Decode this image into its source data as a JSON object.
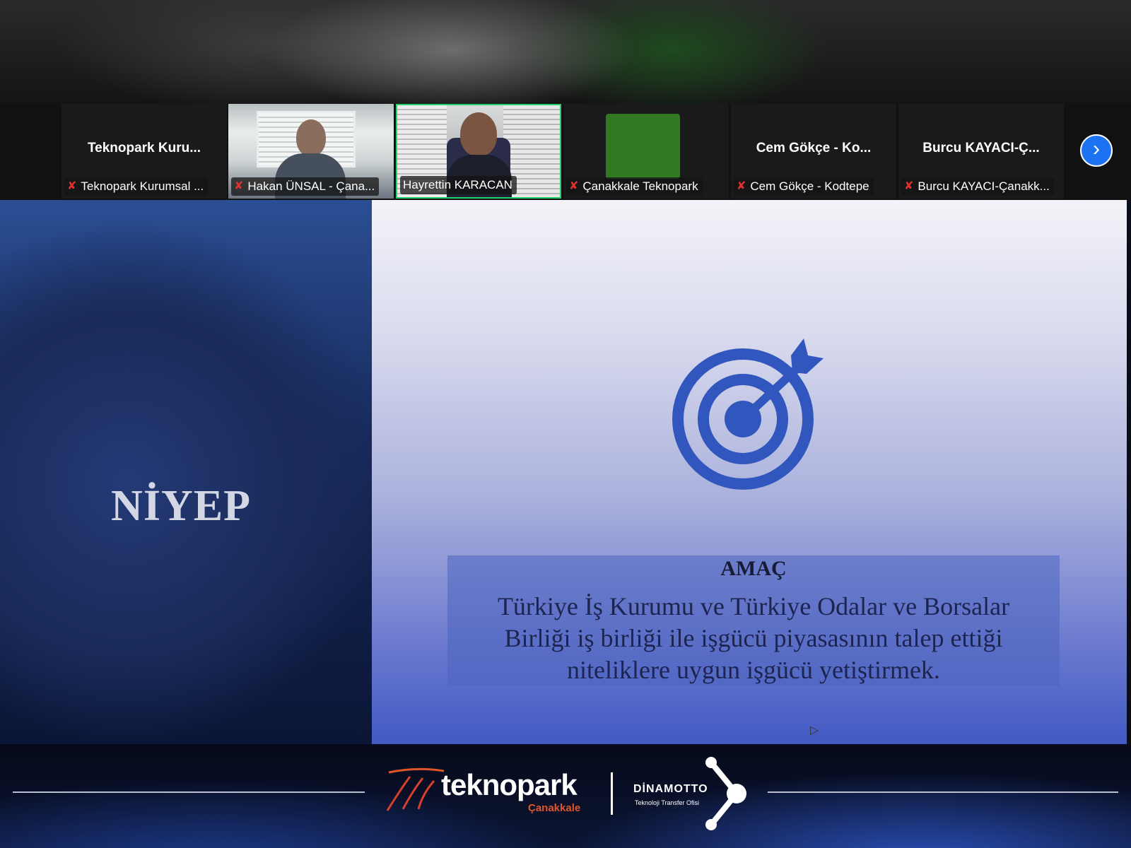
{
  "participants": [
    {
      "big_name": "Teknopark  Kuru...",
      "label": "Teknopark Kurumsal ...",
      "muted": true
    },
    {
      "big_name": "",
      "label": "Hakan ÜNSAL - Çana...",
      "muted": true
    },
    {
      "big_name": "",
      "label": "Hayrettin KARACAN",
      "muted": false,
      "active": true
    },
    {
      "big_name": "",
      "label": "Çanakkale Teknopark",
      "muted": true
    },
    {
      "big_name": "Cem  Gökçe  -  Ko...",
      "label": "Cem Gökçe - Kodtepe",
      "muted": true
    },
    {
      "big_name": "Burcu  KAYACI-Ç...",
      "label": "Burcu KAYACI-Çanakk...",
      "muted": true
    }
  ],
  "next_page_icon": "chevron-right-icon",
  "slide": {
    "left_title": "NİYEP",
    "target_icon": "target-arrow-icon",
    "amac_title": "AMAÇ",
    "amac_text": "Türkiye İş Kurumu ve Türkiye Odalar ve Borsalar Birliği iş birliği ile işgücü piyasasının talep ettiği niteliklere uygun işgücü yetiştirmek."
  },
  "footer": {
    "teknopark_word": "teknopark",
    "teknopark_sub": "Çanakkale",
    "dinamotto_word": "DİNAMOTTO",
    "dinamotto_sub": "Teknoloji Transfer Ofisi"
  },
  "colors": {
    "active_speaker_border": "#22d16b",
    "muted_icon": "#e03131",
    "accent_button": "#1d72f2"
  }
}
